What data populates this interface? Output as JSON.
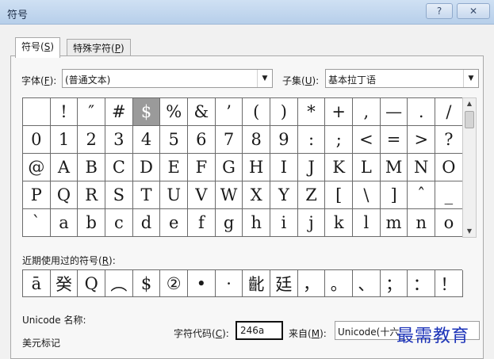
{
  "window": {
    "title": "符号",
    "help_glyph": "?",
    "close_glyph": "✕"
  },
  "tabs": [
    {
      "label": "符号",
      "mnemonic": "S",
      "active": true
    },
    {
      "label": "特殊字符",
      "mnemonic": "P",
      "active": false
    }
  ],
  "font": {
    "label": "字体",
    "mnemonic": "F",
    "value": "(普通文本)"
  },
  "subset": {
    "label": "子集",
    "mnemonic": "U",
    "value": "基本拉丁语"
  },
  "symbol_grid": {
    "rows": [
      [
        " ",
        "!",
        "″",
        "#",
        "$",
        "%",
        "&",
        "’",
        "(",
        ")",
        "*",
        "+",
        ",",
        "—",
        ".",
        "/"
      ],
      [
        "0",
        "1",
        "2",
        "3",
        "4",
        "5",
        "6",
        "7",
        "8",
        "9",
        ":",
        ";",
        "<",
        "=",
        ">",
        "?"
      ],
      [
        "@",
        "A",
        "B",
        "C",
        "D",
        "E",
        "F",
        "G",
        "H",
        "I",
        "J",
        "K",
        "L",
        "M",
        "N",
        "O"
      ],
      [
        "P",
        "Q",
        "R",
        "S",
        "T",
        "U",
        "V",
        "W",
        "X",
        "Y",
        "Z",
        "[",
        "\\",
        "]",
        "ˆ",
        "_"
      ],
      [
        "ˋ",
        "a",
        "b",
        "c",
        "d",
        "e",
        "f",
        "g",
        "h",
        "i",
        "j",
        "k",
        "l",
        "m",
        "n",
        "o"
      ]
    ],
    "selected": "$"
  },
  "recent": {
    "label": "近期使用过的符号",
    "mnemonic": "R",
    "symbols": [
      "ā",
      "癸",
      "Q",
      "︵",
      "$",
      "②",
      "•",
      "·",
      "齔",
      "廷",
      "，",
      "。",
      "、",
      "；",
      "：",
      "！"
    ]
  },
  "unicode_name": {
    "label": "Unicode 名称:",
    "value": "美元标记"
  },
  "char_code": {
    "label": "字符代码",
    "mnemonic": "C",
    "value": "246a"
  },
  "from": {
    "label": "来自",
    "mnemonic": "M",
    "value": "Unicode(十六"
  },
  "watermark": "最需教育",
  "icons": {
    "dropdown": "triangle-down",
    "scroll_up": "triangle-up",
    "scroll_down": "triangle-down"
  }
}
